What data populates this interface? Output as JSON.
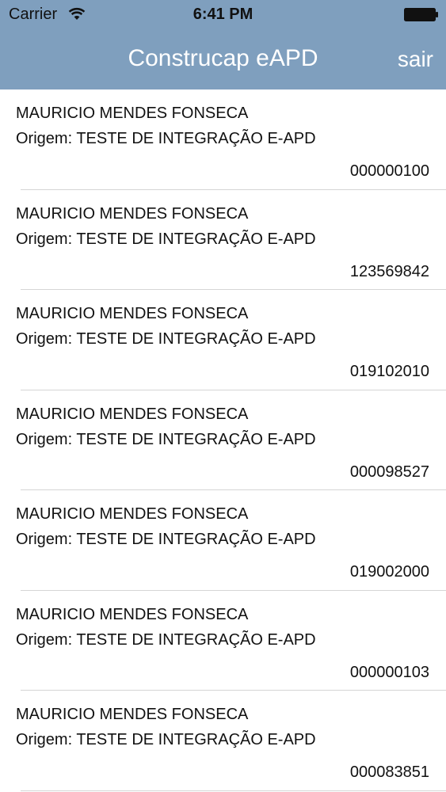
{
  "status_bar": {
    "carrier": "Carrier",
    "time": "6:41 PM",
    "icons": [
      "wifi-icon",
      "battery-icon"
    ]
  },
  "nav": {
    "title": "Construcap eAPD",
    "action_label": "sair"
  },
  "colors": {
    "header_background": "#7f9fbe",
    "header_text": "#ffffff",
    "separator": "#d5d5d5"
  },
  "items": [
    {
      "name": "MAURICIO MENDES FONSECA",
      "origin": "Origem: TESTE DE INTEGRAÇÃO E-APD",
      "code": "000000100"
    },
    {
      "name": "MAURICIO MENDES FONSECA",
      "origin": "Origem: TESTE DE INTEGRAÇÃO E-APD",
      "code": "123569842"
    },
    {
      "name": "MAURICIO MENDES FONSECA",
      "origin": "Origem: TESTE DE INTEGRAÇÃO E-APD",
      "code": "019102010"
    },
    {
      "name": "MAURICIO MENDES FONSECA",
      "origin": "Origem: TESTE DE INTEGRAÇÃO E-APD",
      "code": "000098527"
    },
    {
      "name": "MAURICIO MENDES FONSECA",
      "origin": "Origem: TESTE DE INTEGRAÇÃO E-APD",
      "code": "019002000"
    },
    {
      "name": "MAURICIO MENDES FONSECA",
      "origin": "Origem: TESTE DE INTEGRAÇÃO E-APD",
      "code": "000000103"
    },
    {
      "name": "MAURICIO MENDES FONSECA",
      "origin": "Origem: TESTE DE INTEGRAÇÃO E-APD",
      "code": "000083851"
    }
  ]
}
